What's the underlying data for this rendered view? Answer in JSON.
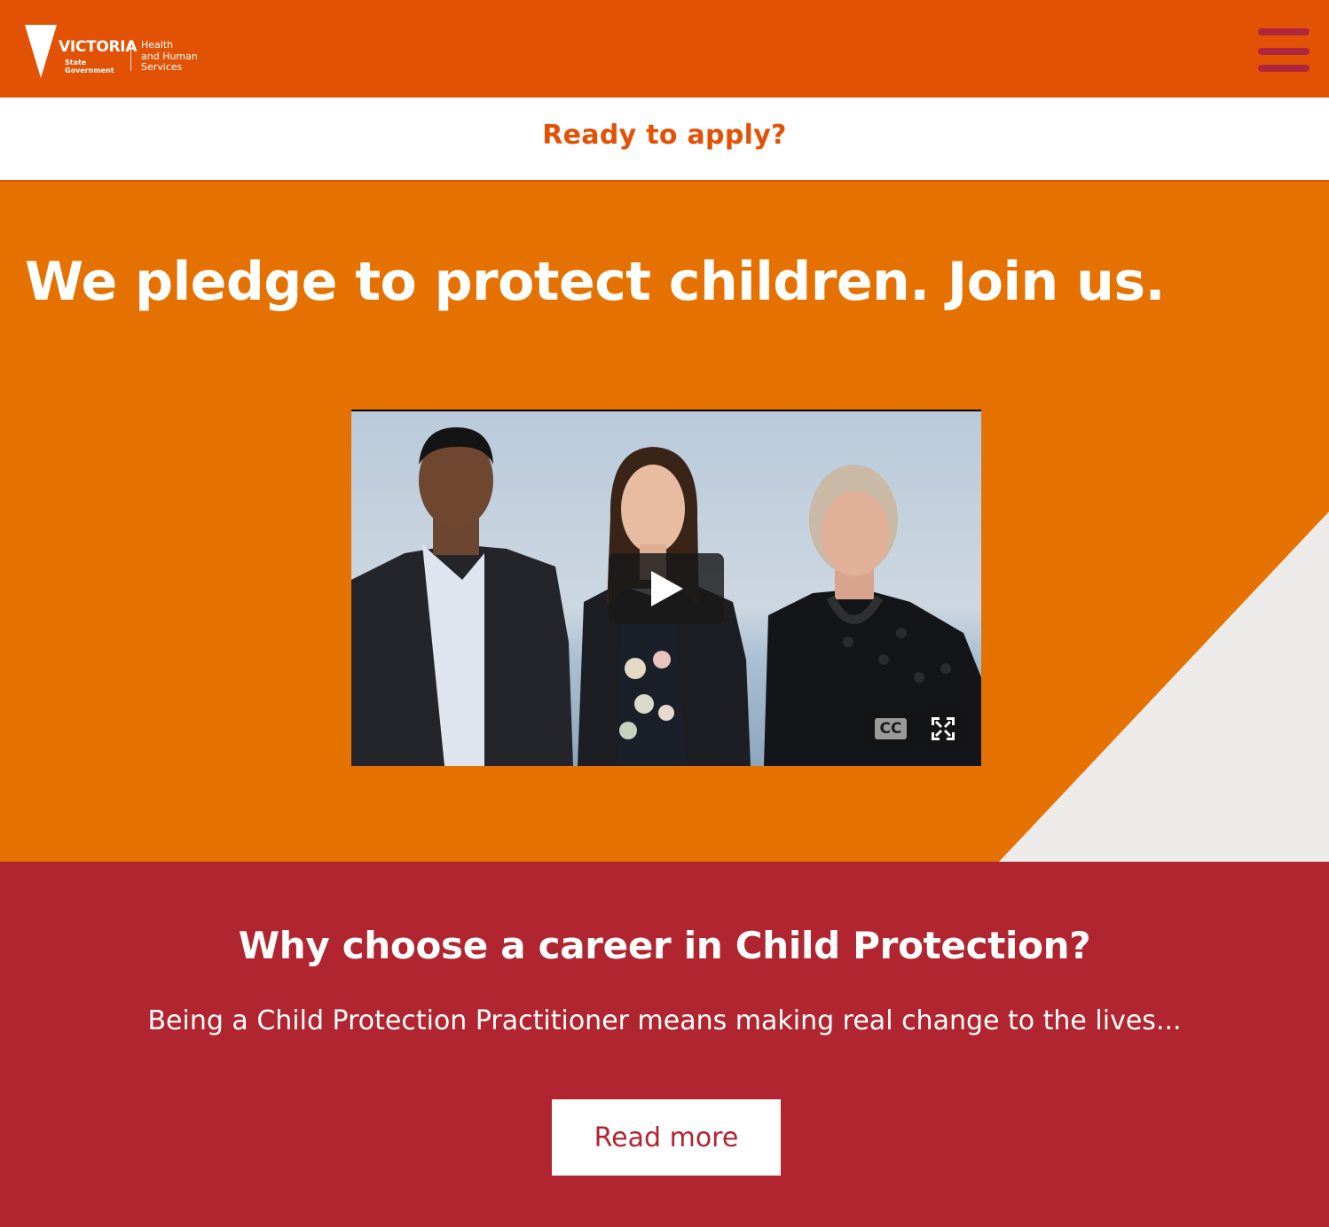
{
  "header": {
    "logo": {
      "wordmark": "VICTORIA",
      "subtitle": "State\nGovernment",
      "department": "Health\nand Human\nServices"
    },
    "menu_icon": "hamburger-icon",
    "brand_color": "#e25205",
    "menu_color": "#b0263a"
  },
  "apply_bar": {
    "link_label": "Ready to apply?"
  },
  "hero": {
    "title": "We pledge to protect children. Join us.",
    "background": "#e57200",
    "wedge_color": "#ecebea",
    "video": {
      "play_icon": "play-icon",
      "captions_label": "CC",
      "fullscreen_icon": "fullscreen-icon"
    }
  },
  "career": {
    "title": "Why choose a career in Child Protection?",
    "text": "Being a Child Protection Practitioner means making real change to the lives...",
    "button_label": "Read more",
    "background": "#b0252f"
  }
}
